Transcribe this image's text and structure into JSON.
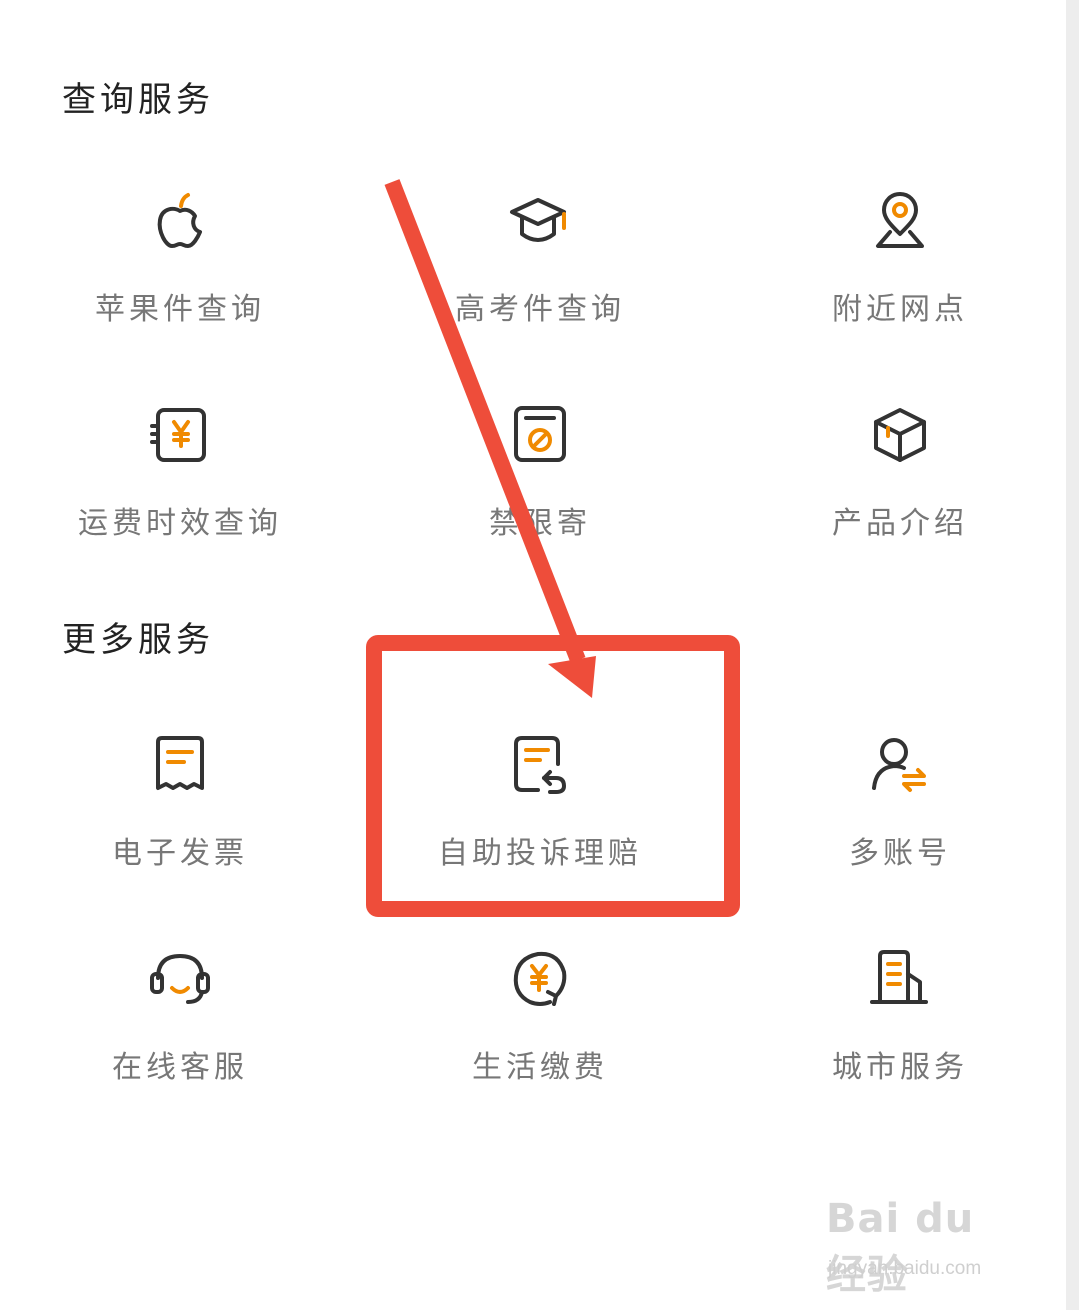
{
  "sections": {
    "query": {
      "title": "查询服务",
      "items": [
        {
          "label": "苹果件查询",
          "icon": "apple-icon"
        },
        {
          "label": "高考件查询",
          "icon": "graduation-cap-icon"
        },
        {
          "label": "附近网点",
          "icon": "location-pin-icon"
        },
        {
          "label": "运费时效查询",
          "icon": "freight-yen-icon"
        },
        {
          "label": "禁限寄",
          "icon": "prohibited-icon"
        },
        {
          "label": "产品介绍",
          "icon": "box-icon"
        }
      ]
    },
    "more": {
      "title": "更多服务",
      "items": [
        {
          "label": "电子发票",
          "icon": "invoice-icon"
        },
        {
          "label": "自助投诉理赔",
          "icon": "claim-return-icon"
        },
        {
          "label": "多账号",
          "icon": "user-switch-icon"
        },
        {
          "label": "在线客服",
          "icon": "headset-icon"
        },
        {
          "label": "生活缴费",
          "icon": "yen-refresh-icon"
        },
        {
          "label": "城市服务",
          "icon": "building-icon"
        }
      ]
    }
  },
  "colors": {
    "accent": "#f08a00",
    "icon_stroke": "#333333",
    "annotation": "#ee4d3a"
  },
  "watermark": {
    "brand": "Bai du 经验",
    "url": "jingyan.baidu.com"
  }
}
